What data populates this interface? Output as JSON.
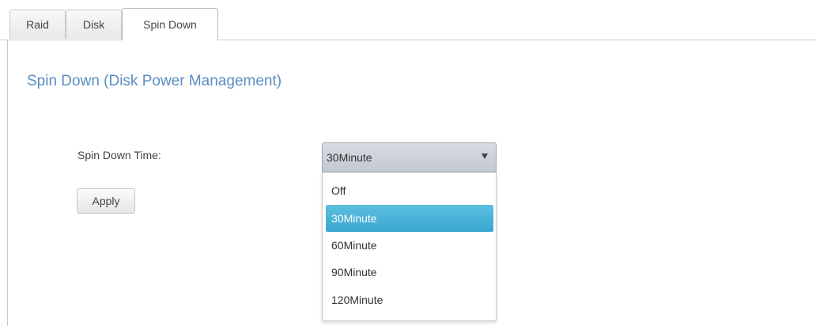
{
  "tabs": [
    {
      "label": "Raid"
    },
    {
      "label": "Disk"
    },
    {
      "label": "Spin Down",
      "active": true
    }
  ],
  "section": {
    "title": "Spin Down (Disk Power Management)"
  },
  "form": {
    "spin_down_label": "Spin Down Time:",
    "apply_label": "Apply",
    "select": {
      "selected": "30Minute",
      "options": [
        "Off",
        "30Minute",
        "60Minute",
        "90Minute",
        "120Minute"
      ],
      "highlighted_index": 1,
      "expanded": true
    }
  },
  "colors": {
    "title_blue": "#5b8cc4",
    "highlight": "#3aa6cf"
  },
  "icons": {
    "select_arrow": "triangle-down-icon"
  }
}
